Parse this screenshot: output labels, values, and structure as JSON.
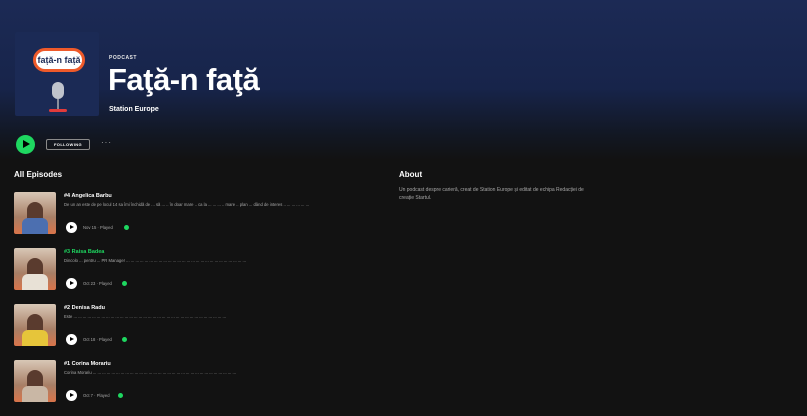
{
  "show": {
    "type_label": "PODCAST",
    "title": "Faţă-n faţă",
    "publisher": "Station Europe",
    "cover_text": "față-n față",
    "follow_label": "FOLLOWING",
    "more_label": "···"
  },
  "episodes_section": {
    "title": "All Episodes"
  },
  "about": {
    "title": "About",
    "text": "Un podcast despre carieră, creat de Station Europe și editat de echipa Redacției de creație Startul."
  },
  "episodes": [
    {
      "title": "#4 Angelica Barbu",
      "description": "De un an este de pe locul 14 sa îmi închidă de ... să ... .. în doar mare .. ca la ... ... ... ..  mare .. plan ... dând de interes .. ... ... ... ... ...",
      "meta": "Nov 15 · Played",
      "shirt_color": "#4c6fb0",
      "active": false
    },
    {
      "title": "#3 Raisa Badea",
      "description": "Dincolo ... pentru ... PR Manager ... ... ... ... ... ... ... ... ... ... ... ... ... ... ... ... ... ... ... ... ... ... ... ... ... ...",
      "meta": "Oct 23 · Played",
      "shirt_color": "#e8e1d6",
      "active": true
    },
    {
      "title": "#2 Denisa Radu",
      "description": "Este ... ... ... ... ... ... ... ... ... ... ... ... ... ... ... ... ... ... ... ... ... ... ... ... ... ... ... ... ... ... ... ... ...",
      "meta": "Oct 18 · Played",
      "shirt_color": "#e6c53a",
      "active": false
    },
    {
      "title": "#1 Corina Morariu",
      "description": "Corina Morariu ... ... ... ... ... ... ... ... ... ... ... ... ... ... ... ... ... ... ... ... ... ... ... ... ... ... ... ... ... ... ...",
      "meta": "Oct 7 · Played",
      "shirt_color": "#c9b7a5",
      "active": false
    }
  ],
  "colors": {
    "accent": "#1ed760",
    "background": "#121212",
    "hero": "#1c2a55"
  }
}
